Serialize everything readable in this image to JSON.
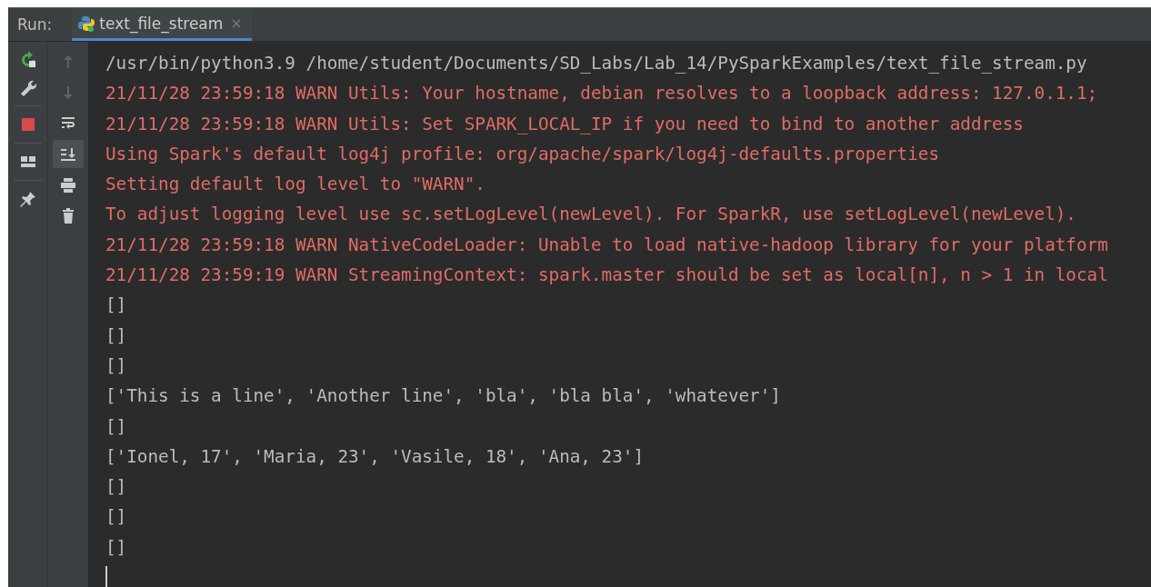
{
  "run_panel": {
    "label": "Run:",
    "tabs": [
      {
        "title": "text_file_stream",
        "close": "×",
        "selected": true
      }
    ]
  },
  "main_toolbar": [
    {
      "kind": "rerun"
    },
    {
      "kind": "wrench"
    },
    {
      "kind": "divider"
    },
    {
      "kind": "stop"
    },
    {
      "kind": "divider"
    },
    {
      "kind": "layout"
    },
    {
      "kind": "divider"
    },
    {
      "kind": "pin"
    }
  ],
  "side_toolbar": [
    {
      "kind": "up",
      "disabled": true,
      "on": false
    },
    {
      "kind": "down",
      "disabled": true,
      "on": false
    },
    {
      "kind": "wrap",
      "disabled": false,
      "on": false
    },
    {
      "kind": "scroll-end",
      "disabled": false,
      "on": true
    },
    {
      "kind": "print",
      "disabled": false,
      "on": false
    },
    {
      "kind": "trash",
      "disabled": false,
      "on": false
    }
  ],
  "console": {
    "lines": [
      {
        "kind": "command",
        "text": "/usr/bin/python3.9 /home/student/Documents/SD_Labs/Lab_14/PySparkExamples/text_file_stream.py"
      },
      {
        "kind": "error",
        "text": "21/11/28 23:59:18 WARN Utils: Your hostname, debian resolves to a loopback address: 127.0.1.1;"
      },
      {
        "kind": "error",
        "text": "21/11/28 23:59:18 WARN Utils: Set SPARK_LOCAL_IP if you need to bind to another address"
      },
      {
        "kind": "error",
        "text": "Using Spark's default log4j profile: org/apache/spark/log4j-defaults.properties"
      },
      {
        "kind": "error",
        "text": "Setting default log level to \"WARN\"."
      },
      {
        "kind": "error",
        "text": "To adjust logging level use sc.setLogLevel(newLevel). For SparkR, use setLogLevel(newLevel)."
      },
      {
        "kind": "error",
        "text": "21/11/28 23:59:18 WARN NativeCodeLoader: Unable to load native-hadoop library for your platform"
      },
      {
        "kind": "error",
        "text": "21/11/28 23:59:19 WARN StreamingContext: spark.master should be set as local[n], n > 1 in local"
      },
      {
        "kind": "output",
        "text": "[]"
      },
      {
        "kind": "output",
        "text": "[]"
      },
      {
        "kind": "output",
        "text": "[]"
      },
      {
        "kind": "output",
        "text": "['This is a line', 'Another line', 'bla', 'bla bla', 'whatever']"
      },
      {
        "kind": "output",
        "text": "[]"
      },
      {
        "kind": "output",
        "text": "['Ionel, 17', 'Maria, 23', 'Vasile, 18', 'Ana, 23']"
      },
      {
        "kind": "output",
        "text": "[]"
      },
      {
        "kind": "output",
        "text": "[]"
      },
      {
        "kind": "output",
        "text": "[]"
      }
    ],
    "cursor": true
  }
}
